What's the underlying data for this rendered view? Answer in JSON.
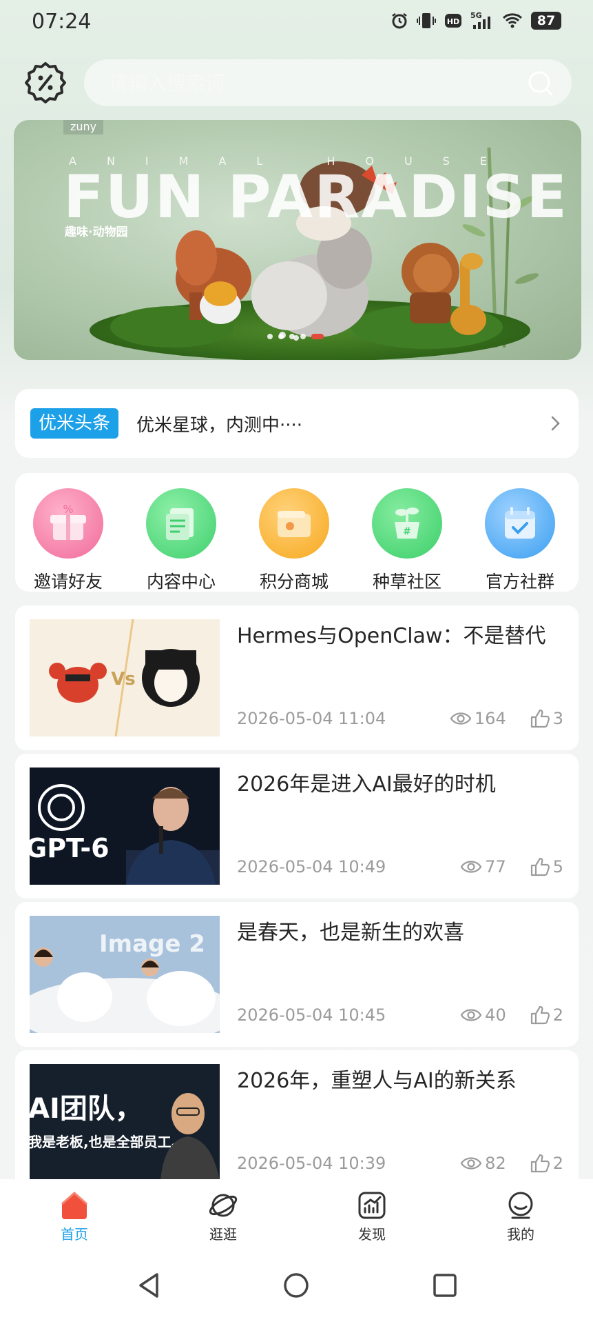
{
  "status_bar": {
    "time": "07:24",
    "network": "5G",
    "hd": "HD",
    "battery": "87"
  },
  "search": {
    "placeholder": "请输入搜索词"
  },
  "banner": {
    "brand": "zuny",
    "subtitle": "ANIMAL HOUSE",
    "title": "FUN PARADISE",
    "caption": "趣味·动物园"
  },
  "ticker": {
    "tag": "优米头条",
    "text": "优米星球，内测中····"
  },
  "shortcuts": [
    {
      "label": "邀请好友",
      "icon": "gift-icon",
      "color": "#f06b9a"
    },
    {
      "label": "内容中心",
      "icon": "document-stack-icon",
      "color": "#3fcf6e"
    },
    {
      "label": "积分商城",
      "icon": "wallet-icon",
      "color": "#f7a81e"
    },
    {
      "label": "种草社区",
      "icon": "sprout-icon",
      "color": "#3ccf6a"
    },
    {
      "label": "官方社群",
      "icon": "calendar-check-icon",
      "color": "#3a9ff0"
    }
  ],
  "articles": [
    {
      "title": "Hermes与OpenClaw：不是替代",
      "date": "2026-05-04 11:04",
      "views": "164",
      "likes": "3",
      "thumb_text": "Vs"
    },
    {
      "title": "2026年是进入AI最好的时机",
      "date": "2026-05-04 10:49",
      "views": "77",
      "likes": "5",
      "thumb_text": "GPT-6"
    },
    {
      "title": "是春天，也是新生的欢喜",
      "date": "2026-05-04 10:45",
      "views": "40",
      "likes": "2",
      "thumb_text": "Image 2"
    },
    {
      "title": "2026年，重塑人与AI的新关系",
      "date": "2026-05-04 10:39",
      "views": "82",
      "likes": "2",
      "thumb_text": "AI团队，",
      "thumb_text2": "我是老板,也是全部员工。"
    }
  ],
  "tabs": [
    {
      "label": "首页",
      "icon": "home-icon"
    },
    {
      "label": "逛逛",
      "icon": "planet-icon"
    },
    {
      "label": "发现",
      "icon": "trend-chart-icon"
    },
    {
      "label": "我的",
      "icon": "profile-icon"
    }
  ],
  "colors": {
    "accent": "#1ca0e8",
    "home_active": "#f0503c"
  }
}
